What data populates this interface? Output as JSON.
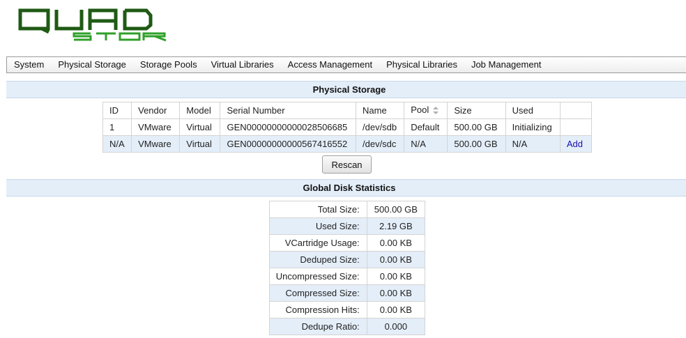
{
  "logo": {
    "text_top": "QUAD",
    "text_bottom": "STOR",
    "colors": {
      "dark_green": "#1f5a14",
      "bright_green": "#2fa02a"
    }
  },
  "menu": {
    "items": [
      "System",
      "Physical Storage",
      "Storage Pools",
      "Virtual Libraries",
      "Access Management",
      "Physical Libraries",
      "Job Management"
    ]
  },
  "physical_storage": {
    "title": "Physical Storage",
    "columns": [
      "ID",
      "Vendor",
      "Model",
      "Serial Number",
      "Name",
      "Pool",
      "Size",
      "Used",
      ""
    ],
    "rows": [
      [
        "1",
        "VMware",
        "Virtual",
        "GEN00000000000028506685",
        "/dev/sdb",
        "Default",
        "500.00 GB",
        "Initializing",
        ""
      ],
      [
        "N/A",
        "VMware",
        "Virtual",
        "GEN00000000000567416552",
        "/dev/sdc",
        "N/A",
        "500.00 GB",
        "N/A",
        "Add"
      ]
    ],
    "rescan_label": "Rescan"
  },
  "global_stats": {
    "title": "Global Disk Statistics",
    "rows": [
      {
        "label": "Total Size:",
        "value": "500.00 GB"
      },
      {
        "label": "Used Size:",
        "value": "2.19 GB"
      },
      {
        "label": "VCartridge Usage:",
        "value": "0.00 KB"
      },
      {
        "label": "Deduped Size:",
        "value": "0.00 KB"
      },
      {
        "label": "Uncompressed Size:",
        "value": "0.00 KB"
      },
      {
        "label": "Compressed Size:",
        "value": "0.00 KB"
      },
      {
        "label": "Compression Hits:",
        "value": "0.00 KB"
      },
      {
        "label": "Dedupe Ratio:",
        "value": "0.000"
      }
    ]
  },
  "colors": {
    "header_bar": "#e4eef9",
    "row_alt": "#e4eef9",
    "link": "#1a0dab"
  }
}
